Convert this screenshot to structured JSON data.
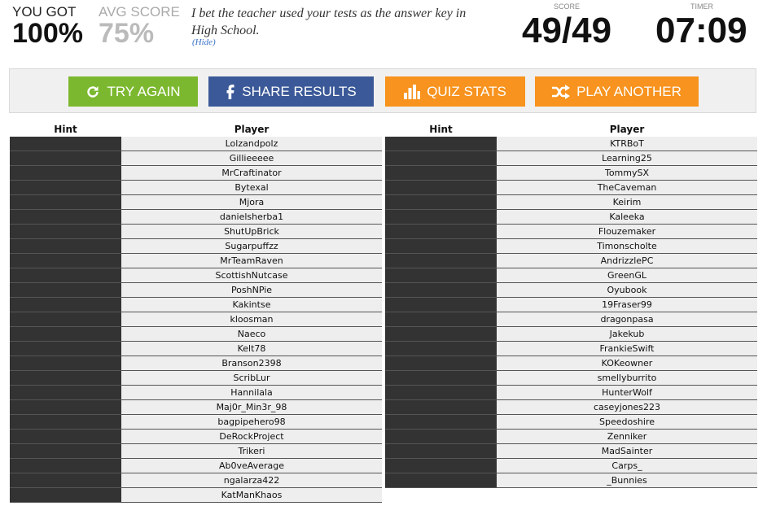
{
  "result": {
    "you_got_label": "YOU GOT",
    "you_got_value": "100%",
    "avg_label": "AVG SCORE",
    "avg_value": "75%",
    "quote": "I bet the teacher used your tests as the answer key in High School.",
    "hide_link": "(Hide)",
    "score_label": "SCORE",
    "score_value": "49/49",
    "timer_label": "TIMER",
    "timer_value": "07:09"
  },
  "buttons": {
    "try_again": "TRY AGAIN",
    "share_results": "SHARE RESULTS",
    "quiz_stats": "QUIZ STATS",
    "play_another": "PLAY ANOTHER",
    "colors": {
      "try_again": "#7cb82f",
      "share": "#3b5998",
      "stats": "#f7931e",
      "play": "#f7931e"
    },
    "icons": {
      "try_again": "refresh-icon",
      "share": "facebook-icon",
      "stats": "bar-chart-icon",
      "play": "shuffle-icon"
    }
  },
  "table": {
    "hint_header": "Hint",
    "player_header": "Player",
    "left_players": [
      "Lolzandpolz",
      "Gillieeeee",
      "MrCraftinator",
      "Bytexal",
      "Mjora",
      "danielsherba1",
      "ShutUpBrick",
      "Sugarpuffzz",
      "MrTeamRaven",
      "ScottishNutcase",
      "PoshNPie",
      "Kakintse",
      "kloosman",
      "Naeco",
      "Kelt78",
      "Branson2398",
      "ScribLur",
      "Hannilala",
      "Maj0r_Min3r_98",
      "bagpipehero98",
      "DeRockProject",
      "Trikeri",
      "Ab0veAverage",
      "ngalarza422",
      "KatManKhaos"
    ],
    "right_players": [
      "KTRBoT",
      "Learning25",
      "TommySX",
      "TheCaveman",
      "Keirim",
      "Kaleeka",
      "Flouzemaker",
      "Timonscholte",
      "AndrizzlePC",
      "GreenGL",
      "Oyubook",
      "19Fraser99",
      "dragonpasa",
      "Jakekub",
      "FrankieSwift",
      "KOKeowner",
      "smellyburrito",
      "HunterWolf",
      "caseyjones223",
      "Speedoshire",
      "Zenniker",
      "MadSainter",
      "Carps_",
      "_Bunnies"
    ]
  }
}
